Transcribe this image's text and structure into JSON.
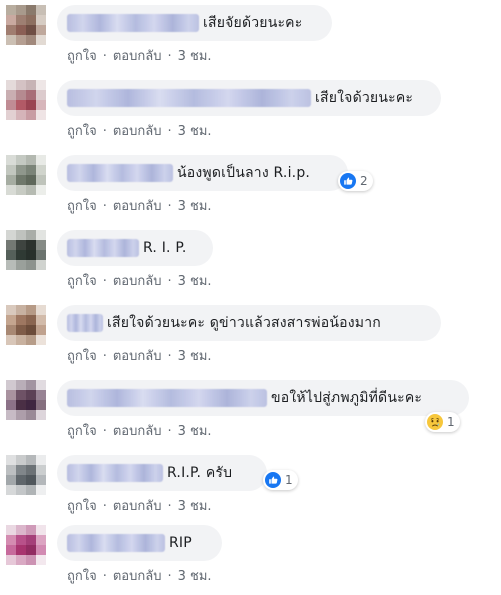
{
  "action_labels": {
    "like": "ถูกใจ",
    "reply": "ตอบกลับ",
    "time": "3 ชม."
  },
  "colors": {
    "bubble": "#f2f3f5",
    "text": "#1c1e21",
    "meta": "#606770",
    "like_blue": "#1877f2",
    "sad_yellow": "#f7c73c"
  },
  "comments": [
    {
      "text": "เสียจัยด้วยนะคะ",
      "reaction": null,
      "avatar": [
        "#b8ad9f",
        "#a89a8c",
        "#8a7a6c",
        "#c8bfb5",
        "#c9a9a0",
        "#9e7f72",
        "#8d6f60",
        "#d6ccc3",
        "#a07d70",
        "#8b5f55",
        "#6f4e44",
        "#bfa89c",
        "#cbbfb3",
        "#b59f92",
        "#a1897c",
        "#e2dad3"
      ]
    },
    {
      "text": "เสียใจด้วยนะคะ",
      "reaction": null,
      "avatar": [
        "#e4dada",
        "#d4c2c4",
        "#c7b3b5",
        "#eee6e6",
        "#c9aeb1",
        "#b58a90",
        "#a86e78",
        "#dccbcd",
        "#c08c94",
        "#b25a66",
        "#9a4452",
        "#d7b6bb",
        "#e2d0d2",
        "#d5b4b9",
        "#c89ca3",
        "#efe4e5"
      ]
    },
    {
      "text": "น้องพูดเป็นลาง R.i.p.",
      "reaction": {
        "type": "like",
        "count": "2"
      },
      "avatar": [
        "#d9dcd7",
        "#c4c9c2",
        "#b3b8b0",
        "#e8eae6",
        "#c2c7bf",
        "#8f978c",
        "#7b8478",
        "#d0d4cc",
        "#a6ada2",
        "#6f786b",
        "#5f685b",
        "#bfc4bb",
        "#d8dbd5",
        "#c7cbc3",
        "#b6bbb2",
        "#eceeea"
      ]
    },
    {
      "text": "R. I. P.",
      "reaction": null,
      "avatar": [
        "#d4d6d3",
        "#bfc2be",
        "#a9ada8",
        "#e2e4e1",
        "#737873",
        "#3e4440",
        "#2c322e",
        "#868b86",
        "#55605a",
        "#2f3a34",
        "#27302b",
        "#6c746f",
        "#b7bcb8",
        "#9aa09b",
        "#8d938e",
        "#d0d3cf"
      ]
    },
    {
      "text": "เสียใจด้วยนะคะ ดูข่าวแล้วสงสารพ่อน้องมาก",
      "reaction": null,
      "avatar": [
        "#d9c9bd",
        "#c7b1a1",
        "#b69a86",
        "#e6dbd2",
        "#c4a58f",
        "#9e7761",
        "#8a6550",
        "#d2bbaa",
        "#a88873",
        "#7f5c48",
        "#6c4c3a",
        "#c0a28e",
        "#d8c6b8",
        "#c8b19f",
        "#b79d89",
        "#ece2da"
      ]
    },
    {
      "text": "ขอให้ไปสู่ภพภูมิที่ดีนะคะ",
      "reaction": {
        "type": "sad",
        "count": "1"
      },
      "avatar": [
        "#d1c9d0",
        "#b9aeb8",
        "#a294a1",
        "#e1dbe0",
        "#a9929f",
        "#6e5266",
        "#5c4156",
        "#988394",
        "#8c7288",
        "#4a2f45",
        "#3f2640",
        "#86707f",
        "#c7bbc5",
        "#ad9eaa",
        "#9a8a97",
        "#ddd5db"
      ]
    },
    {
      "text": "R.I.P. ครับ",
      "reaction": {
        "type": "like",
        "count": "1"
      },
      "avatar": [
        "#dfe0e1",
        "#c9cbcc",
        "#b5b8ba",
        "#ebeced",
        "#bcbfc1",
        "#80868a",
        "#6c7276",
        "#cbcecf",
        "#a2a7aa",
        "#5f666b",
        "#50575c",
        "#b4b8bb",
        "#d6d8d9",
        "#c3c6c8",
        "#b0b4b6",
        "#eeeff0"
      ]
    },
    {
      "text": "RIP",
      "reaction": null,
      "avatar": [
        "#ead8e2",
        "#dbb6cb",
        "#cf9ab8",
        "#f1e4eb",
        "#d48cb1",
        "#b8518a",
        "#a53f79",
        "#dca4c2",
        "#c76a9c",
        "#a8346f",
        "#922c62",
        "#d28ab2",
        "#e6c8d8",
        "#d9a9c3",
        "#cc93b3",
        "#f3e8ee"
      ]
    }
  ]
}
